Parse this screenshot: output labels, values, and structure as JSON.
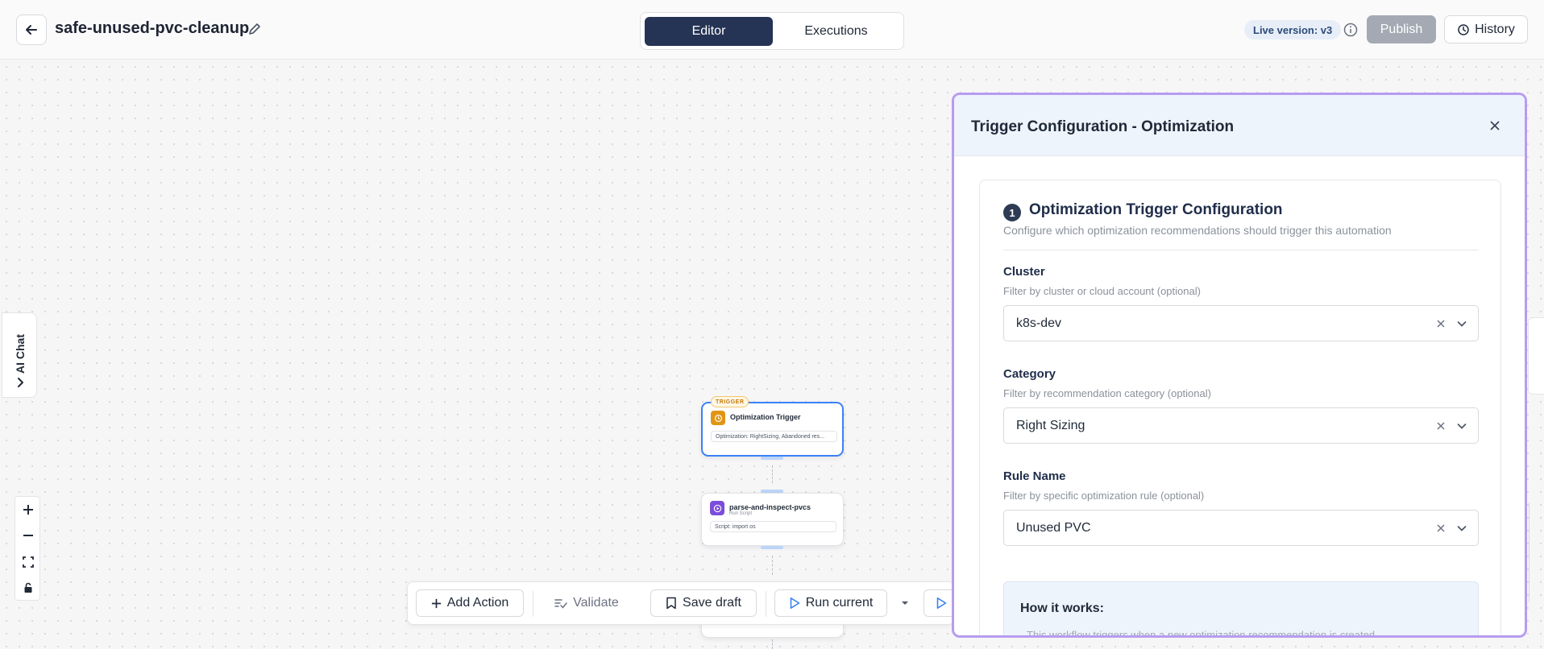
{
  "header": {
    "workflow_name": "safe-unused-pvc-cleanup",
    "tabs": [
      {
        "label": "Editor",
        "active": true
      },
      {
        "label": "Executions",
        "active": false
      }
    ],
    "live_version": "Live version: v3",
    "publish_label": "Publish",
    "history_label": "History"
  },
  "side": {
    "ai_chat_label": "AI Chat"
  },
  "nodes": {
    "trigger": {
      "tag": "TRIGGER",
      "title": "Optimization Trigger",
      "field": "Optimization: RightSizing, Abandoned res..."
    },
    "script": {
      "title": "parse-and-inspect-pvcs",
      "subtitle": "Run Script",
      "field": "Script: import os"
    }
  },
  "toolbar": {
    "add_action": "Add Action",
    "validate": "Validate",
    "save_draft": "Save draft",
    "run_current": "Run current"
  },
  "panel": {
    "title": "Trigger Configuration - Optimization",
    "step_number": "1",
    "section_title": "Optimization Trigger Configuration",
    "section_desc": "Configure which optimization recommendations should trigger this automation",
    "fields": [
      {
        "label": "Cluster",
        "help": "Filter by cluster or cloud account (optional)",
        "value": "k8s-dev"
      },
      {
        "label": "Category",
        "help": "Filter by recommendation category (optional)",
        "value": "Right Sizing"
      },
      {
        "label": "Rule Name",
        "help": "Filter by specific optimization rule (optional)",
        "value": "Unused PVC"
      }
    ],
    "how_it_works_title": "How it works:",
    "how_it_works_text": "This workflow triggers when a new optimization recommendation is created"
  },
  "colors": {
    "accent_dark": "#253454",
    "panel_border": "#b79cf0",
    "trigger_border": "#3b82f6",
    "trigger_icon": "#e19514",
    "script_icon": "#7c4ddb"
  },
  "icons": [
    "arrow-left-icon",
    "pencil-icon",
    "info-icon",
    "history-icon",
    "chevron-right-icon",
    "plus-icon",
    "minus-icon",
    "fit-view-icon",
    "lock-icon",
    "validate-icon",
    "bookmark-icon",
    "play-icon",
    "caret-down-icon",
    "close-icon",
    "clear-icon",
    "chevron-down-icon"
  ]
}
